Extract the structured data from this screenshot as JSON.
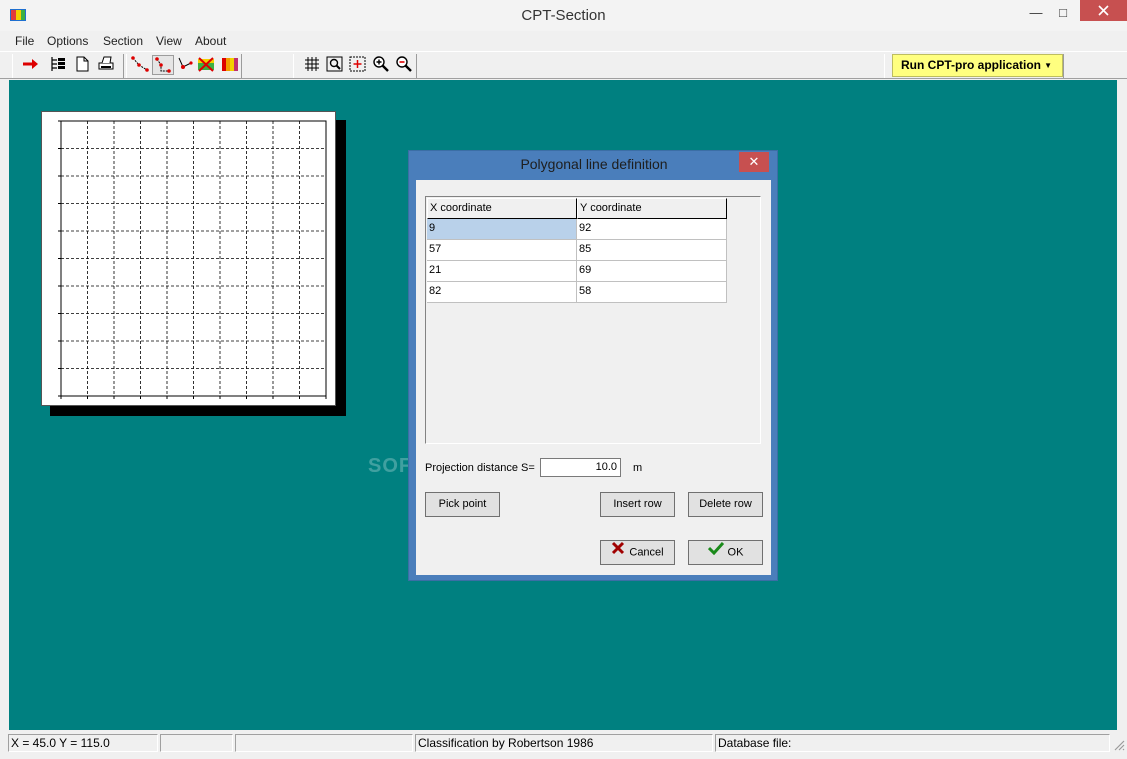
{
  "window": {
    "title": "CPT-Section",
    "minimize_icon": "minimize-icon",
    "maximize_icon": "maximize-icon",
    "close_icon": "close-icon"
  },
  "menu": {
    "items": [
      "File",
      "Options",
      "Section",
      "View",
      "About"
    ]
  },
  "toolbar": {
    "icons": [
      "arrow-right-icon",
      "tree-list-icon",
      "new-document-icon",
      "print-icon",
      "polyline-icon",
      "edit-polyline-icon",
      "point-line-icon",
      "section-cross-icon",
      "color-section-icon",
      "grid-icon",
      "zoom-window-icon",
      "zoom-center-icon",
      "zoom-in-icon",
      "zoom-out-icon"
    ],
    "run_label": "Run CPT-pro application"
  },
  "dialog": {
    "title": "Polygonal line definition",
    "columns": [
      "X coordinate",
      "Y coordinate"
    ],
    "rows": [
      [
        "9",
        "92"
      ],
      [
        "57",
        "85"
      ],
      [
        "21",
        "69"
      ],
      [
        "82",
        "58"
      ]
    ],
    "projection_label": "Projection distance S=",
    "projection_value": "10.0",
    "projection_unit": "m",
    "pick_point_label": "Pick point",
    "insert_row_label": "Insert row",
    "delete_row_label": "Delete row",
    "cancel_label": "Cancel",
    "ok_label": "OK",
    "colors": {
      "title_bar": "#4a7ebb",
      "close": "#c75050",
      "selection": "#b9d1ea"
    }
  },
  "workspace": {
    "background": "#008080"
  },
  "status": {
    "coords": "X = 45.0 Y = 115.0",
    "panel2": "",
    "panel3": "",
    "classification": "Classification by Robertson 1986",
    "database": "Database file:"
  },
  "watermark": "SOFTPEDIA"
}
